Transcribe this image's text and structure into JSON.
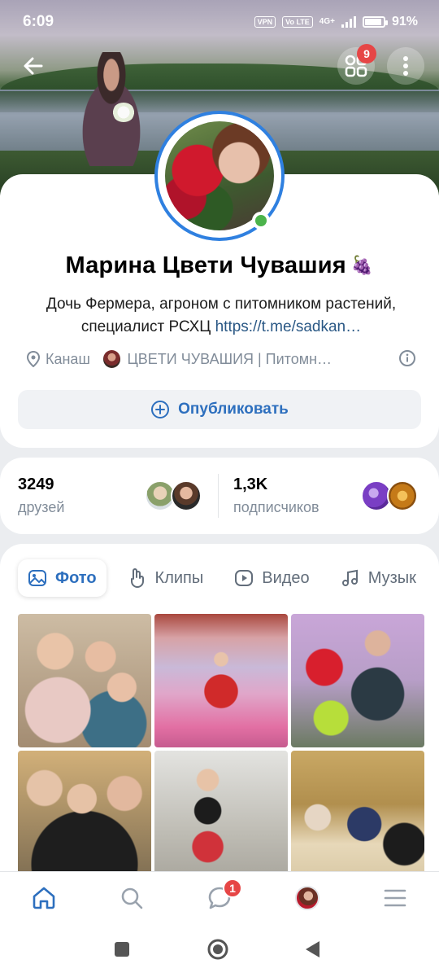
{
  "status_bar": {
    "time": "6:09",
    "vpn": "VPN",
    "volte": "Vo LTE",
    "network": "4G+",
    "battery_pct": "91%",
    "battery_level": 0.91
  },
  "header": {
    "apps_badge": "9"
  },
  "profile": {
    "name": "Марина Цвети Чувашия",
    "name_emoji": "🍇",
    "bio_text": "Дочь Фермера, агроном с питомником растений, специалист РСХЦ ",
    "bio_link": "https://t.me/sadkan…",
    "city": "Канаш",
    "group": "ЦВЕТИ ЧУВАШИЯ | Питомн…",
    "publish_label": "Опубликовать",
    "online": true
  },
  "stats": {
    "friends_count": "3249",
    "friends_label": "друзей",
    "subscribers_count": "1,3K",
    "subscribers_label": "подписчиков"
  },
  "tabs": [
    {
      "label": "Фото",
      "icon": "photo-icon",
      "active": true
    },
    {
      "label": "Клипы",
      "icon": "clips-icon",
      "active": false
    },
    {
      "label": "Видео",
      "icon": "video-icon",
      "active": false
    },
    {
      "label": "Музык",
      "icon": "music-icon",
      "active": false
    }
  ],
  "bottom_nav": {
    "messages_badge": "1",
    "items": [
      "home-icon",
      "search-icon",
      "messages-icon",
      "profile-avatar",
      "menu-icon"
    ]
  },
  "colors": {
    "accent": "#2d6fbe",
    "avatar_ring": "#2f80e0",
    "online": "#4bb34b",
    "badge": "#e64646",
    "secondary_text": "#818c99"
  }
}
